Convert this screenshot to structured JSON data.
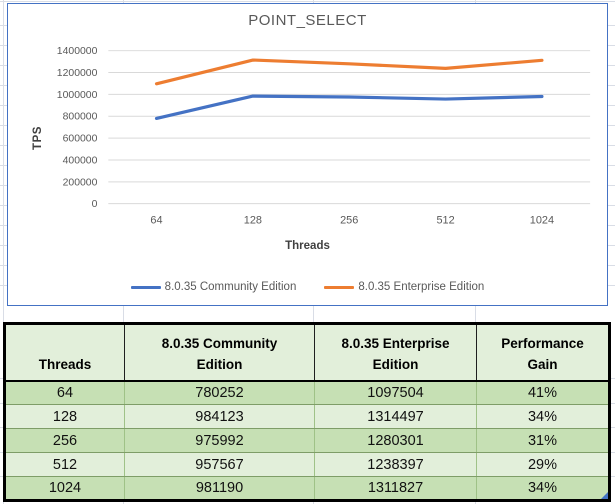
{
  "chart_data": {
    "type": "line",
    "title": "POINT_SELECT",
    "xlabel": "Threads",
    "ylabel": "TPS",
    "categories": [
      "64",
      "128",
      "256",
      "512",
      "1024"
    ],
    "series": [
      {
        "name": "8.0.35 Community Edition",
        "color": "#4472C4",
        "values": [
          780252,
          984123,
          975992,
          957567,
          981190
        ]
      },
      {
        "name": "8.0.35 Enterprise Edition",
        "color": "#ED7D31",
        "values": [
          1097504,
          1314497,
          1280301,
          1238397,
          1311827
        ]
      }
    ],
    "ylim": [
      0,
      1400000
    ],
    "ytick_step": 200000,
    "ytick_labels": [
      "0",
      "200000",
      "400000",
      "600000",
      "800000",
      "1000000",
      "1200000",
      "1400000"
    ],
    "grid": true,
    "gridline_color": "#D9D9D9",
    "axis_text_color": "#595959",
    "legend_position": "bottom",
    "chart_border_color": "#4472C4"
  },
  "table": {
    "headers": [
      "Threads",
      "8.0.35 Community Edition",
      "8.0.35 Enterprise Edition",
      "Performance Gain"
    ],
    "rows": [
      [
        "64",
        "780252",
        "1097504",
        "41%"
      ],
      [
        "128",
        "984123",
        "1314497",
        "34%"
      ],
      [
        "256",
        "975992",
        "1280301",
        "31%"
      ],
      [
        "512",
        "957567",
        "1238397",
        "29%"
      ],
      [
        "1024",
        "981190",
        "1311827",
        "34%"
      ]
    ],
    "header_bg": "#E2EFDA",
    "row_bg_dark": "#C6E0B4",
    "row_bg_light": "#E2EFDA"
  }
}
